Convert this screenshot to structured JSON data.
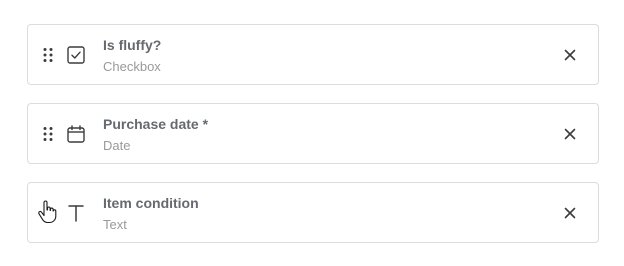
{
  "fields": [
    {
      "title": "Is fluffy?",
      "type_label": "Checkbox",
      "type_icon": "checkbox-icon",
      "show_drag_handle": true
    },
    {
      "title": "Purchase date *",
      "type_label": "Date",
      "type_icon": "calendar-icon",
      "show_drag_handle": true
    },
    {
      "title": "Item condition",
      "type_label": "Text",
      "type_icon": "text-icon",
      "show_drag_handle": false,
      "hover_cursor": "pointer-hand-icon"
    }
  ],
  "colors": {
    "border": "#dcdcdc",
    "title": "#666a6e",
    "subtitle": "#9a9a9a",
    "icon": "#3c3c3c"
  }
}
